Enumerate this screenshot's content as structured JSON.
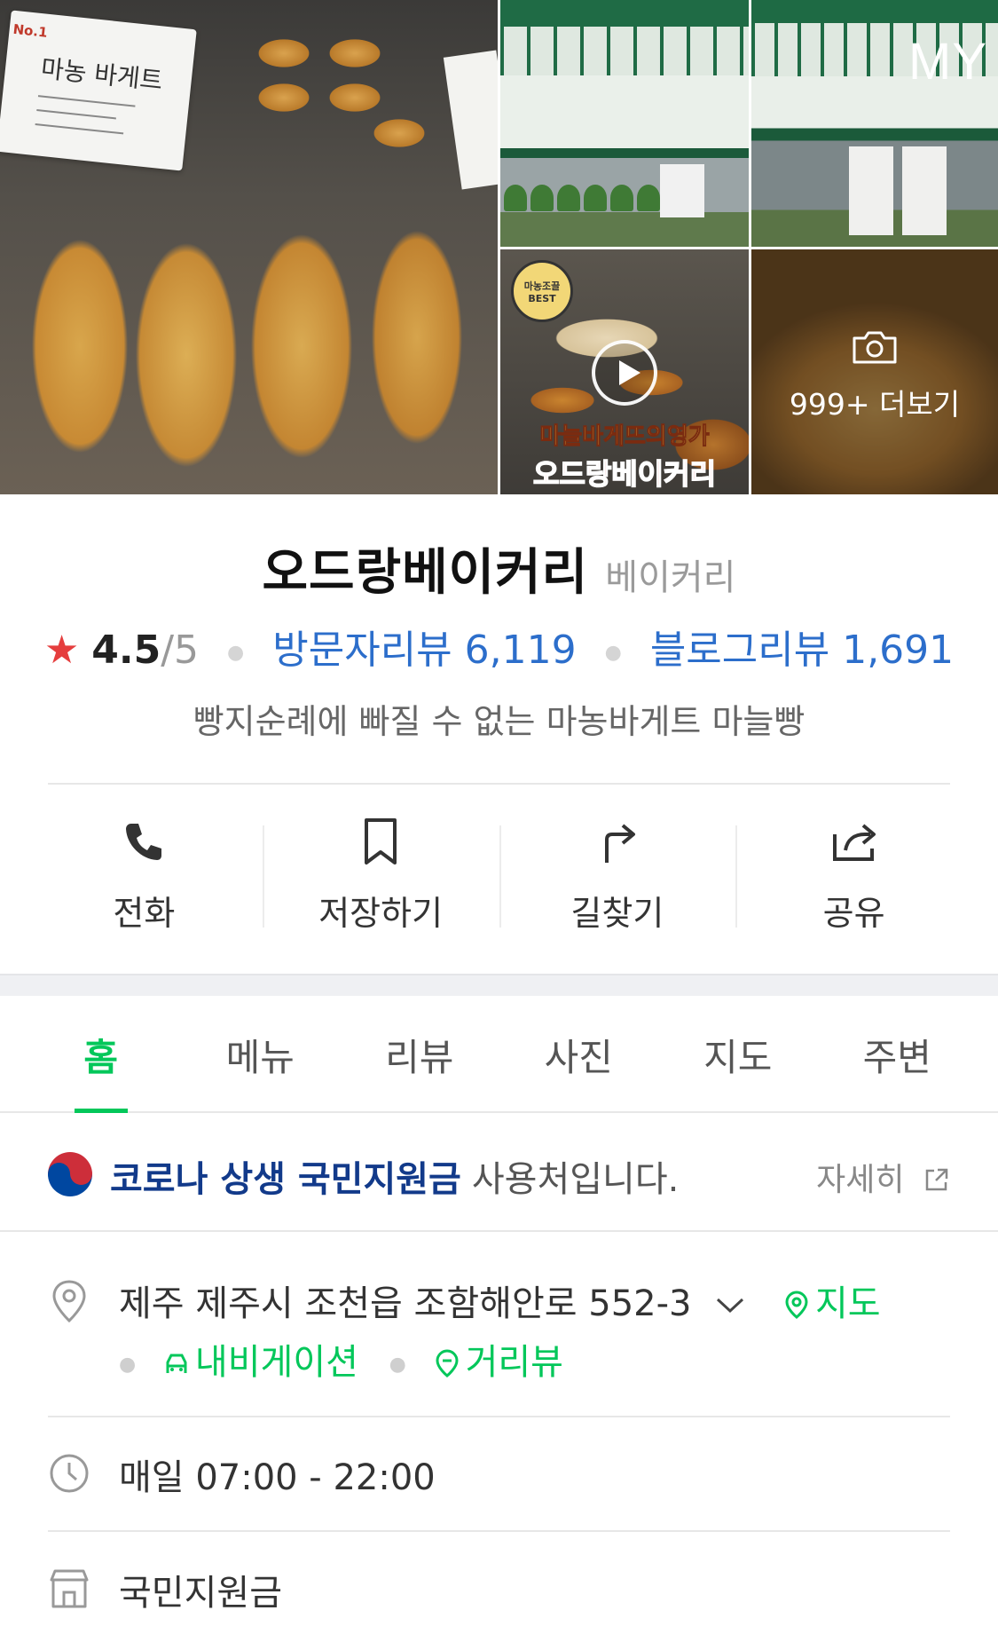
{
  "gallery": {
    "main_photo_tag_title": "마농 바게트",
    "main_photo_tag_badge": "No.1",
    "top_right_badge": "MY",
    "video_badge": "마농조끌 BEST",
    "video_caption_line1": "마늘바게뜨의영가",
    "video_caption_line2": "오드랑베이커리",
    "more_label": "999+ 더보기"
  },
  "place": {
    "name": "오드랑베이커리",
    "category": "베이커리",
    "rating": "4.5",
    "rating_max": "/5",
    "visitor_reviews": "방문자리뷰 6,119",
    "blog_reviews": "블로그리뷰 1,691",
    "description": "빵지순례에 빠질 수 없는 마농바게트 마늘빵"
  },
  "actions": [
    {
      "label": "전화",
      "icon": "phone-icon"
    },
    {
      "label": "저장하기",
      "icon": "bookmark-icon"
    },
    {
      "label": "길찾기",
      "icon": "directions-icon"
    },
    {
      "label": "공유",
      "icon": "share-icon"
    }
  ],
  "tabs": [
    "홈",
    "메뉴",
    "리뷰",
    "사진",
    "지도",
    "주변"
  ],
  "active_tab": "홈",
  "covid": {
    "title": "코로나 상생 국민지원금",
    "suffix": "사용처입니다.",
    "detail": "자세히"
  },
  "address": {
    "text": "제주 제주시 조천읍 조함해안로 552-3",
    "map": "지도",
    "navigation": "내비게이션",
    "street_view": "거리뷰"
  },
  "hours": "매일 07:00 - 22:00",
  "support": "국민지원금",
  "colors": {
    "accent_green": "#03c75a",
    "link_blue": "#2c6ecb",
    "star_red": "#e53e3e",
    "covid_navy": "#123a8a"
  }
}
